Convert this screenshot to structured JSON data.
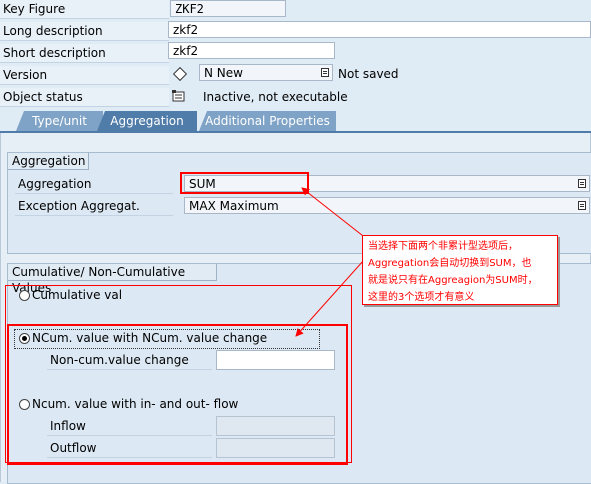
{
  "header": {
    "key_figure": {
      "label": "Key Figure",
      "value": "ZKF2"
    },
    "long_description": {
      "label": "Long description",
      "value": "zkf2"
    },
    "short_description": {
      "label": "Short description",
      "value": "zkf2"
    },
    "version": {
      "label": "Version",
      "value": "N New",
      "status": "Not saved"
    },
    "object_status": {
      "label": "Object status",
      "value": "Inactive, not executable"
    }
  },
  "tabs": [
    {
      "label": "Type/unit",
      "active": false
    },
    {
      "label": "Aggregation",
      "active": true
    },
    {
      "label": "Additional Properties",
      "active": false
    }
  ],
  "aggregation_group": {
    "title": "Aggregation",
    "aggregation": {
      "label": "Aggregation",
      "value": "SUM"
    },
    "exception": {
      "label": "Exception Aggregat.",
      "value": "MAX Maximum"
    }
  },
  "cumulative_group": {
    "title": "Cumulative/ Non-Cumulative Values",
    "options": [
      {
        "label": "Cumulative val",
        "selected": false
      },
      {
        "label": "NCum. value with NCum. value change",
        "selected": true
      },
      {
        "label": "Ncum. value with in- and out- flow",
        "selected": false
      }
    ],
    "noncum_change": {
      "label": "Non-cum.value change",
      "value": ""
    },
    "inflow": {
      "label": "Inflow",
      "value": ""
    },
    "outflow": {
      "label": "Outflow",
      "value": ""
    }
  },
  "annotation": {
    "lines": [
      "当选择下面两个非累计型选项后，",
      "Aggregation会自动切换到SUM，也",
      "就是说只有在Aggreagion为SUM时，",
      "这里的3个选项才有意义"
    ],
    "color": "#ff0000"
  },
  "colors": {
    "tab_active": "#5c87b2",
    "tab_inactive": "#7fa3c7",
    "annotation_red": "#ff0000"
  }
}
